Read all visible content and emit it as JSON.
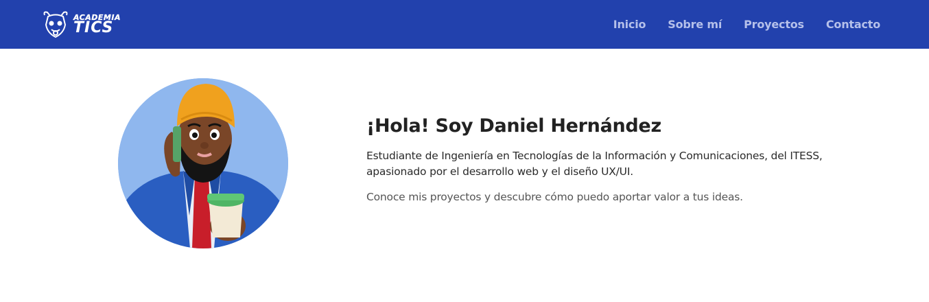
{
  "header": {
    "logo": {
      "icon": "bull-logo-icon",
      "top_text": "ACADEMIA",
      "bottom_text": "TICS"
    },
    "nav": [
      {
        "label": "Inicio"
      },
      {
        "label": "Sobre mí"
      },
      {
        "label": "Proyectos"
      },
      {
        "label": "Contacto"
      }
    ]
  },
  "hero": {
    "avatar_icon": "avatar-illustration",
    "title": "¡Hola! Soy Daniel Hernández",
    "description": "Estudiante de Ingeniería en Tecnologías de la Información y Comunicaciones, del ITESS, apasionado por el desarrollo web y el diseño UX/UI.",
    "cta_text": "Conoce mis proyectos y descubre cómo puedo aportar valor a tus ideas."
  },
  "colors": {
    "header_bg": "#2241ad",
    "nav_text": "#b5c0ea",
    "avatar_bg": "#8fb7ee"
  }
}
